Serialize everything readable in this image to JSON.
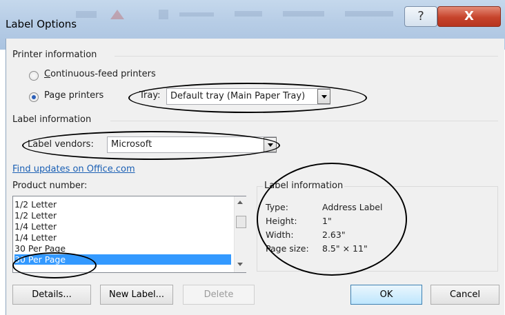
{
  "window": {
    "title": "Label Options",
    "help_glyph": "?",
    "close_glyph": "X"
  },
  "printer_info": {
    "group_title": "Printer information",
    "continuous_label": "Continuous-feed printers",
    "page_printers_label": "Page printers",
    "selected": "page_printers",
    "tray_label": "Tray:",
    "tray_value": "Default tray (Main Paper Tray)"
  },
  "label_info_group": {
    "group_title": "Label information",
    "vendors_label": "Label vendors:",
    "vendors_value": "Microsoft",
    "find_updates_link": "Find updates on Office.com",
    "product_number_label": "Product number:"
  },
  "products": {
    "items": [
      "1/2 Letter",
      "1/2 Letter",
      "1/4 Letter",
      "1/4 Letter",
      "30 Per Page",
      "30 Per Page"
    ],
    "selected_index": 5
  },
  "details_panel": {
    "title": "Label information",
    "type_label": "Type:",
    "type_value": "Address Label",
    "height_label": "Height:",
    "height_value": "1\"",
    "width_label": "Width:",
    "width_value": "2.63\"",
    "pagesize_label": "Page size:",
    "pagesize_value": "8.5\" × 11\""
  },
  "buttons": {
    "details": "Details...",
    "new_label": "New Label...",
    "delete": "Delete",
    "ok": "OK",
    "cancel": "Cancel"
  },
  "colors": {
    "selection": "#3399ff",
    "link": "#1a5fb4",
    "close": "#c6432b"
  }
}
